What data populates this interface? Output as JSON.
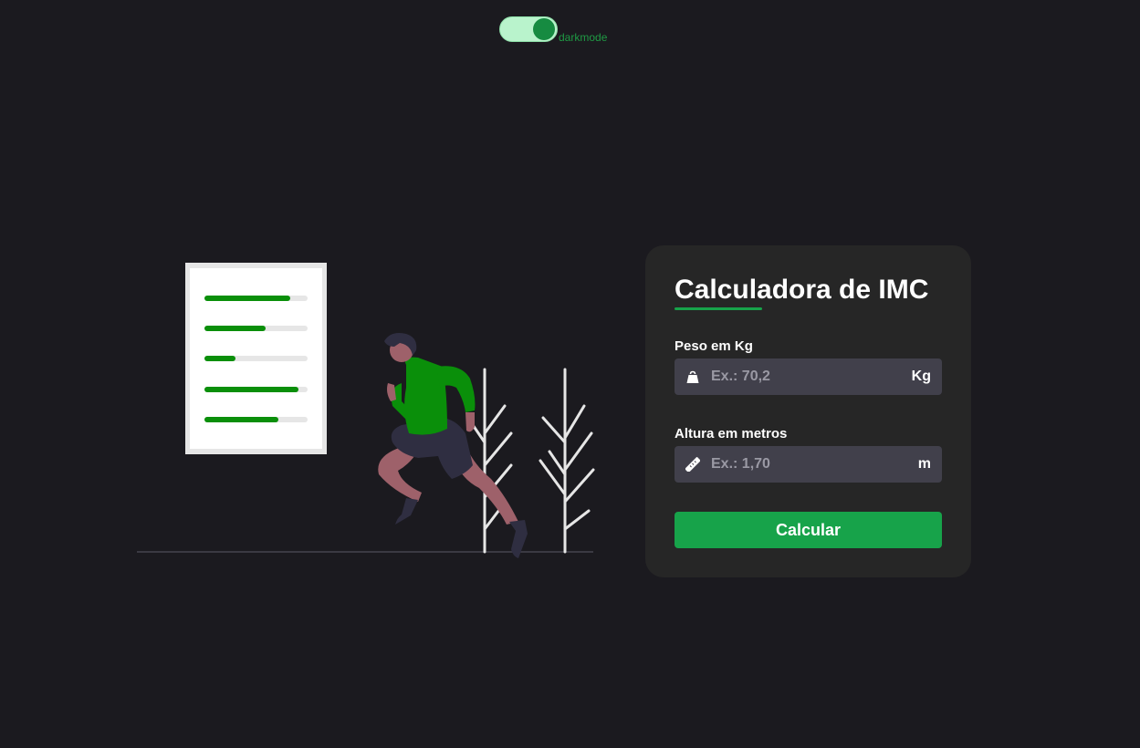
{
  "darkmode_toggle": {
    "label": "darkmode",
    "state": "on"
  },
  "calculator": {
    "title": "Calculadora de IMC",
    "weight": {
      "label": "Peso em Kg",
      "placeholder": "Ex.: 70,2",
      "unit": "Kg",
      "icon": "weight-icon"
    },
    "height": {
      "label": "Altura em metros",
      "placeholder": "Ex.: 1,70",
      "unit": "m",
      "icon": "ruler-icon"
    },
    "submit_label": "Calcular"
  },
  "colors": {
    "background": "#1b1a1f",
    "card": "#262626",
    "accent": "#17a34a",
    "input": "#41404b"
  }
}
